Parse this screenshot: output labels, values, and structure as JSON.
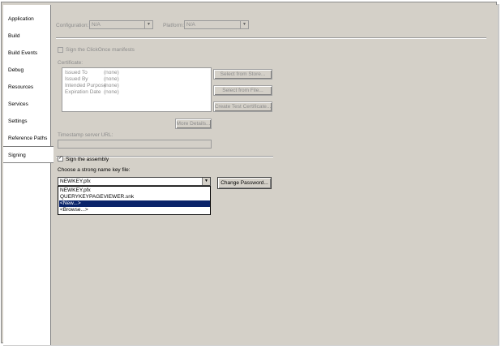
{
  "tabs": [
    {
      "label": "Application"
    },
    {
      "label": "Build"
    },
    {
      "label": "Build Events"
    },
    {
      "label": "Debug"
    },
    {
      "label": "Resources"
    },
    {
      "label": "Services"
    },
    {
      "label": "Settings"
    },
    {
      "label": "Reference Paths"
    },
    {
      "label": "Signing",
      "active": true
    }
  ],
  "config": {
    "configuration_label": "Configuration:",
    "configuration_value": "N/A",
    "platform_label": "Platform:",
    "platform_value": "N/A"
  },
  "clickonce": {
    "checkbox_label": "Sign the ClickOnce manifests",
    "checked": false
  },
  "certificate": {
    "label": "Certificate:",
    "rows": [
      {
        "key": "Issued To",
        "value": "(none)"
      },
      {
        "key": "Issued By",
        "value": "(none)"
      },
      {
        "key": "Intended Purpose",
        "value": "(none)"
      },
      {
        "key": "Expiration Date",
        "value": "(none)"
      }
    ],
    "select_from_store": "Select from Store...",
    "select_from_file": "Select from File...",
    "create_test_certificate": "Create Test Certificate...",
    "more_details": "More Details..."
  },
  "timestamp": {
    "label": "Timestamp server URL:",
    "value": ""
  },
  "assembly": {
    "checkbox_label": "Sign the assembly",
    "checked": true,
    "key_file_label": "Choose a strong name key file:",
    "key_file_value": "NEWKEY.pfx",
    "change_password": "Change Password...",
    "options": [
      {
        "label": "NEWKEY.pfx",
        "selected": false
      },
      {
        "label": "QUERYKEYPAGEVIEWER.snk",
        "selected": false
      },
      {
        "label": "<New...>",
        "selected": true
      },
      {
        "label": "<Browse...>",
        "selected": false
      }
    ]
  },
  "colors": {
    "panel": "#d4d0c8",
    "selection": "#0a246a",
    "disabled_text": "#8c8c8c"
  }
}
